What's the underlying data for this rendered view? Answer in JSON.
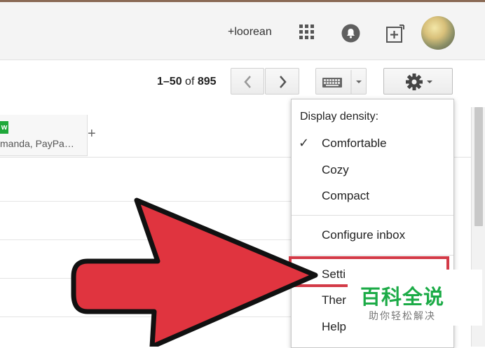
{
  "header": {
    "user_link": "+loorean"
  },
  "toolbar": {
    "pager_range": "1–50",
    "pager_of": " of ",
    "pager_total": "895"
  },
  "tabs": [
    {
      "badge": "w",
      "snippet": "manda, PayPa…"
    }
  ],
  "add_tab_label": "+",
  "settings_menu": {
    "density_header": "Display density:",
    "density_options": [
      "Comfortable",
      "Cozy",
      "Compact"
    ],
    "selected_density": "Comfortable",
    "configure_inbox": "Configure inbox",
    "settings": "Setti",
    "themes": "Ther",
    "help": "Help"
  },
  "watermark": {
    "main": "百科全说",
    "sub": "助你轻松解决"
  },
  "colors": {
    "highlight": "#d33a47",
    "arrow": "#e0343f",
    "watermark_green": "#1cab47"
  }
}
